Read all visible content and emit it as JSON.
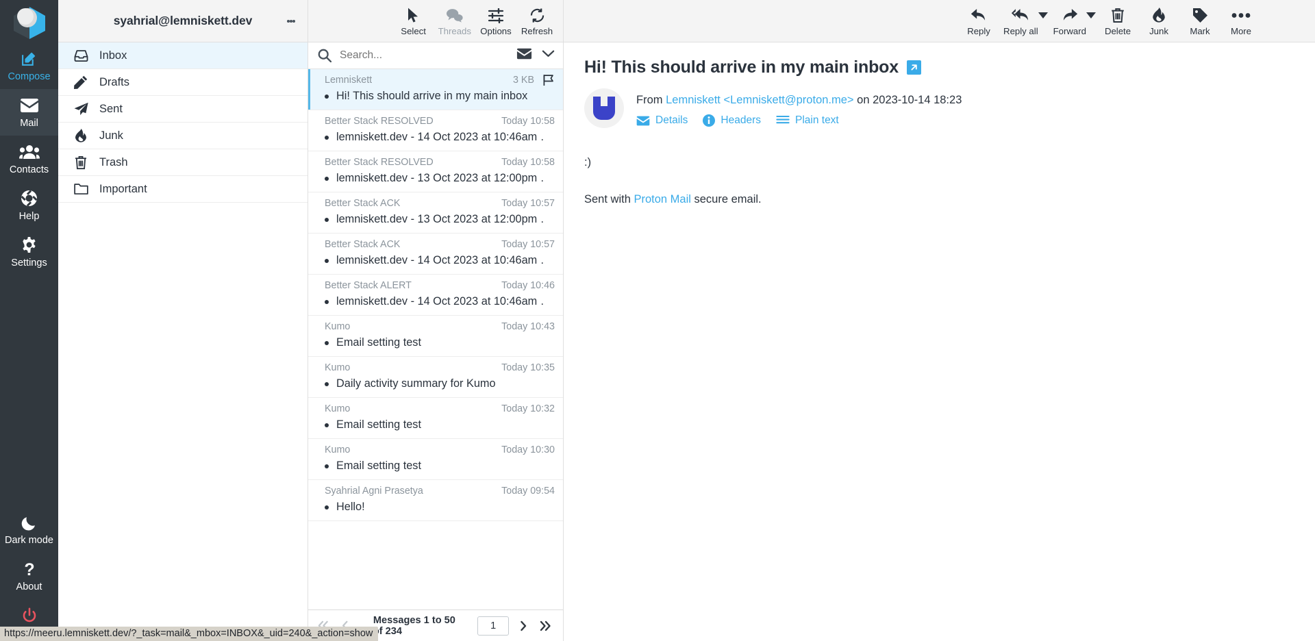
{
  "taskbar": {
    "logo_name": "roundcube-logo",
    "items": [
      {
        "label": "Compose",
        "icon": "compose-icon",
        "state": "accent"
      },
      {
        "label": "Mail",
        "icon": "envelope-icon",
        "state": "active"
      },
      {
        "label": "Contacts",
        "icon": "contacts-icon",
        "state": "normal"
      },
      {
        "label": "Help",
        "icon": "lifebuoy-icon",
        "state": "normal"
      },
      {
        "label": "Settings",
        "icon": "gear-icon",
        "state": "normal"
      }
    ],
    "bottom_items": [
      {
        "label": "Dark mode",
        "icon": "moon-icon"
      },
      {
        "label": "About",
        "icon": "question-icon"
      },
      {
        "label": "Logout",
        "icon": "power-icon"
      }
    ]
  },
  "folders": {
    "account": "syahrial@lemniskett.dev",
    "options_icon": "kebab-menu-icon",
    "items": [
      {
        "label": "Inbox",
        "icon": "inbox-icon",
        "selected": true
      },
      {
        "label": "Drafts",
        "icon": "pencil-icon",
        "selected": false
      },
      {
        "label": "Sent",
        "icon": "paper-plane-icon",
        "selected": false
      },
      {
        "label": "Junk",
        "icon": "fire-icon",
        "selected": false
      },
      {
        "label": "Trash",
        "icon": "trash-icon",
        "selected": false
      },
      {
        "label": "Important",
        "icon": "folder-icon",
        "selected": false
      }
    ]
  },
  "list_toolbar": [
    {
      "label": "Select",
      "icon": "cursor-icon",
      "disabled": false
    },
    {
      "label": "Threads",
      "icon": "threads-icon",
      "disabled": true
    },
    {
      "label": "Options",
      "icon": "sliders-icon",
      "disabled": false
    },
    {
      "label": "Refresh",
      "icon": "refresh-icon",
      "disabled": false
    }
  ],
  "search": {
    "placeholder": "Search...",
    "icon": "search-icon",
    "scope_icon": "envelope-icon",
    "expand_icon": "chevron-down-icon"
  },
  "messages": [
    {
      "from": "Lemniskett",
      "date": "",
      "size": "3 KB",
      "subject": "Hi! This should arrive in my main inbox",
      "selected": true,
      "flagged": true
    },
    {
      "from": "Better Stack RESOLVED",
      "date": "Today 10:58",
      "size": "",
      "subject": "lemniskett.dev - 14 Oct 2023 at 10:46am …",
      "selected": false,
      "flagged": false
    },
    {
      "from": "Better Stack RESOLVED",
      "date": "Today 10:58",
      "size": "",
      "subject": "lemniskett.dev - 13 Oct 2023 at 12:00pm …",
      "selected": false,
      "flagged": false
    },
    {
      "from": "Better Stack ACK",
      "date": "Today 10:57",
      "size": "",
      "subject": "lemniskett.dev - 13 Oct 2023 at 12:00pm …",
      "selected": false,
      "flagged": false
    },
    {
      "from": "Better Stack ACK",
      "date": "Today 10:57",
      "size": "",
      "subject": "lemniskett.dev - 14 Oct 2023 at 10:46am …",
      "selected": false,
      "flagged": false
    },
    {
      "from": "Better Stack ALERT",
      "date": "Today 10:46",
      "size": "",
      "subject": "lemniskett.dev - 14 Oct 2023 at 10:46am …",
      "selected": false,
      "flagged": false
    },
    {
      "from": "Kumo",
      "date": "Today 10:43",
      "size": "",
      "subject": "Email setting test",
      "selected": false,
      "flagged": false
    },
    {
      "from": "Kumo",
      "date": "Today 10:35",
      "size": "",
      "subject": "Daily activity summary for Kumo",
      "selected": false,
      "flagged": false
    },
    {
      "from": "Kumo",
      "date": "Today 10:32",
      "size": "",
      "subject": "Email setting test",
      "selected": false,
      "flagged": false
    },
    {
      "from": "Kumo",
      "date": "Today 10:30",
      "size": "",
      "subject": "Email setting test",
      "selected": false,
      "flagged": false
    },
    {
      "from": "Syahrial Agni Prasetya",
      "date": "Today 09:54",
      "size": "",
      "subject": "Hello!",
      "selected": false,
      "flagged": false
    }
  ],
  "pagination": {
    "first_icon": "double-chevron-left-icon",
    "prev_icon": "chevron-left-icon",
    "next_icon": "chevron-right-icon",
    "last_icon": "double-chevron-right-icon",
    "summary": "Messages 1 to 50 of 234",
    "page_value": "1"
  },
  "view_toolbar": [
    {
      "label": "Reply",
      "icon": "reply-icon",
      "has_caret": false
    },
    {
      "label": "Reply all",
      "icon": "reply-all-icon",
      "has_caret": true
    },
    {
      "label": "Forward",
      "icon": "forward-icon",
      "has_caret": true
    },
    {
      "label": "Delete",
      "icon": "trash-icon",
      "has_caret": false
    },
    {
      "label": "Junk",
      "icon": "fire-icon",
      "has_caret": false
    },
    {
      "label": "Mark",
      "icon": "tag-icon",
      "has_caret": false
    },
    {
      "label": "More",
      "icon": "ellipsis-icon",
      "has_caret": false
    }
  ],
  "message": {
    "subject": "Hi! This should arrive in my main inbox",
    "open_new_window_icon": "external-link-icon",
    "avatar_icon": "proton-logo-icon",
    "from_prefix": "From",
    "from_name_email": "Lemniskett <Lemniskett@proton.me>",
    "date_prefix": "on 2023-10-14 18:23",
    "header_links": [
      {
        "label": "Details",
        "icon": "envelope-icon"
      },
      {
        "label": "Headers",
        "icon": "info-icon"
      },
      {
        "label": "Plain text",
        "icon": "lines-icon"
      }
    ],
    "body_emoticon": ":)",
    "signature_prefix": "Sent with ",
    "signature_link": "Proton Mail",
    "signature_suffix": " secure email."
  },
  "statusbar": {
    "url": "https://meeru.lemniskett.dev/?_task=mail&_mbox=INBOX&_uid=240&_action=show"
  },
  "colors": {
    "accent": "#3aabe8",
    "taskbar_bg": "#31383e",
    "selected_row": "#eaf6fd",
    "logout_red": "#e8535f"
  }
}
